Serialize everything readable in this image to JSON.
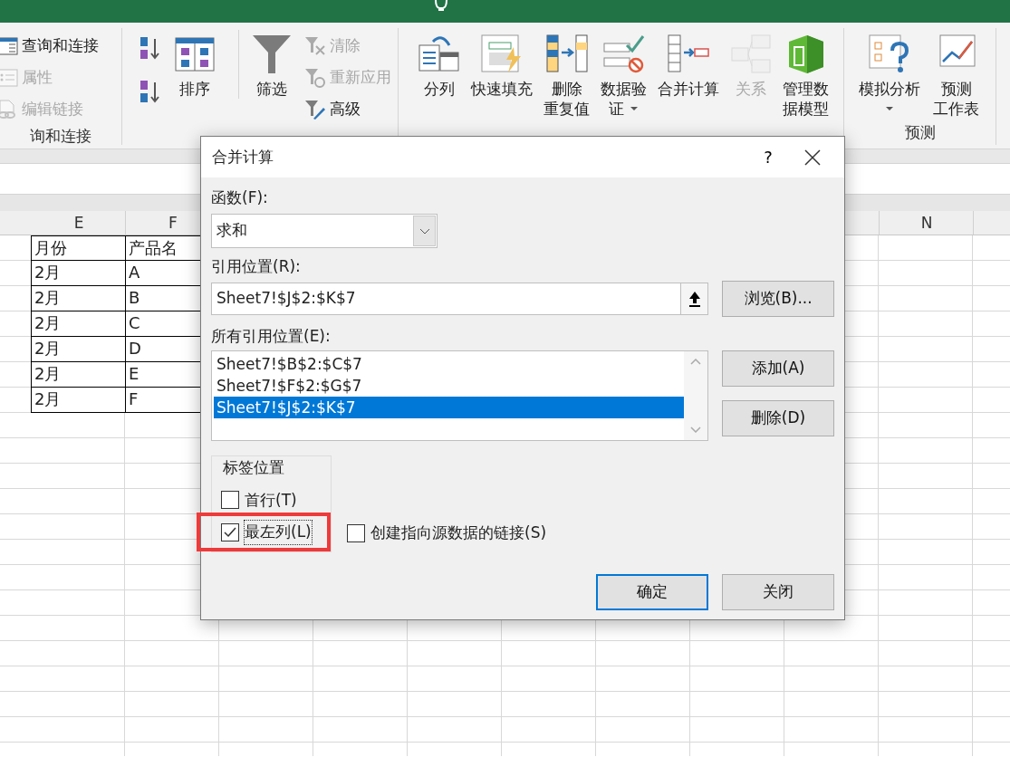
{
  "tab_bar": {
    "search": {
      "kind": "lightbulb"
    }
  },
  "ribbon": {
    "groups": [
      {
        "label": "询和连接",
        "items": [
          {
            "kind": "small",
            "label": "查询和连接",
            "disabled": false
          },
          {
            "kind": "small",
            "label": "属性",
            "disabled": true
          },
          {
            "kind": "small",
            "label": "编辑链接",
            "disabled": true
          }
        ]
      },
      {
        "items": [
          {
            "kind": "icon"
          },
          {
            "kind": "icon"
          },
          {
            "kind": "large",
            "lines": [
              "排序"
            ],
            "disabled": false
          },
          {
            "kind": "large",
            "lines": [
              "筛选"
            ],
            "disabled": false,
            "separated": true
          },
          {
            "kind": "small",
            "label": "清除",
            "disabled": true
          },
          {
            "kind": "small",
            "label": "重新应用",
            "disabled": true
          },
          {
            "kind": "small",
            "label": "高级",
            "disabled": false
          }
        ]
      },
      {
        "items": [
          {
            "kind": "large",
            "lines": [
              "分列"
            ],
            "disabled": false
          },
          {
            "kind": "large",
            "lines": [
              "快速填充"
            ],
            "disabled": false
          },
          {
            "kind": "large",
            "lines": [
              "删除",
              "重复值"
            ],
            "disabled": false
          },
          {
            "kind": "large",
            "lines": [
              "数据验",
              "证"
            ],
            "dropdown": true,
            "disabled": false
          },
          {
            "kind": "large",
            "lines": [
              "合并计算"
            ],
            "disabled": false
          },
          {
            "kind": "large",
            "lines": [
              "关系"
            ],
            "disabled": true
          },
          {
            "kind": "large",
            "lines": [
              "管理数",
              "据模型"
            ],
            "disabled": false
          }
        ]
      },
      {
        "label": "预测",
        "items": [
          {
            "kind": "large",
            "lines": [
              "模拟分析"
            ],
            "dropdown": true,
            "disabled": false
          },
          {
            "kind": "large",
            "lines": [
              "预测",
              "工作表"
            ],
            "disabled": false
          }
        ]
      }
    ]
  },
  "sheet": {
    "columns": [
      {
        "header": "E"
      },
      {
        "header": "F"
      },
      {},
      {},
      {},
      {},
      {},
      {},
      {},
      {
        "header": "N"
      }
    ],
    "rows": [
      [
        "月份",
        "产品名"
      ],
      [
        "2月",
        "A"
      ],
      [
        "2月",
        "B"
      ],
      [
        "2月",
        "C"
      ],
      [
        "2月",
        "D"
      ],
      [
        "2月",
        "E"
      ],
      [
        "2月",
        "F"
      ]
    ]
  },
  "dialog": {
    "title": "合并计算",
    "help": "?",
    "function": {
      "label": "函数(F):",
      "value": "求和"
    },
    "reference": {
      "label": "引用位置(R):",
      "value": "Sheet7!$J$2:$K$7"
    },
    "browse_button": "浏览(B)...",
    "all_references": {
      "label": "所有引用位置(E):",
      "items": [
        {
          "text": "Sheet7!$B$2:$C$7",
          "selected": false
        },
        {
          "text": "Sheet7!$F$2:$G$7",
          "selected": false
        },
        {
          "text": "Sheet7!$J$2:$K$7",
          "selected": true
        }
      ]
    },
    "add_button": "添加(A)",
    "delete_button": "删除(D)",
    "label_position": {
      "title": "标签位置",
      "options": [
        {
          "label": "首行(T)",
          "checked": false,
          "focused": false,
          "highlighted": false
        },
        {
          "label": "最左列(L)",
          "checked": true,
          "focused": true,
          "highlighted": true
        }
      ]
    },
    "link_option": {
      "label": "创建指向源数据的链接(S)",
      "checked": false
    },
    "ok_button": {
      "label": "确定",
      "default": true
    },
    "close_button": "关闭"
  }
}
